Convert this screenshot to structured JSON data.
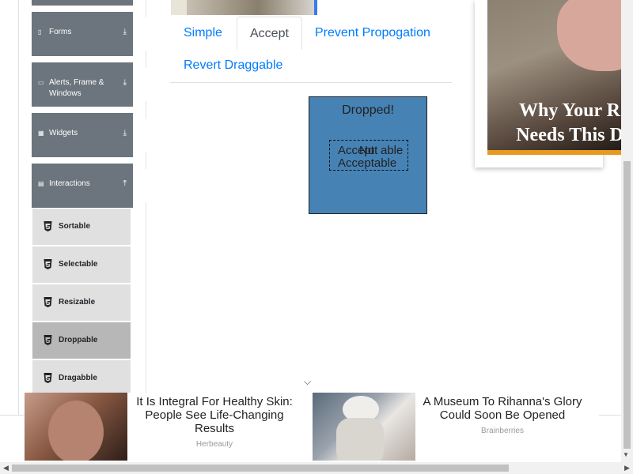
{
  "sidebar": {
    "groups": [
      {
        "label": "Forms",
        "icon": "file-icon",
        "arrow": "download-arrow-icon"
      },
      {
        "label": "Alerts, Frame & Windows",
        "icon": "window-icon",
        "arrow": "download-arrow-icon"
      },
      {
        "label": "Widgets",
        "icon": "grid-icon",
        "arrow": "download-arrow-icon"
      },
      {
        "label": "Interactions",
        "icon": "list-icon",
        "arrow": "upload-arrow-icon"
      }
    ],
    "interactions": [
      {
        "label": "Sortable",
        "active": false
      },
      {
        "label": "Selectable",
        "active": false
      },
      {
        "label": "Resizable",
        "active": false
      },
      {
        "label": "Droppable",
        "active": true
      },
      {
        "label": "Dragabble",
        "active": false
      }
    ]
  },
  "tabs": [
    {
      "label": "Simple",
      "active": false
    },
    {
      "label": "Accept",
      "active": true
    },
    {
      "label": "Prevent Propogation",
      "active": false
    },
    {
      "label": "Revert Draggable",
      "active": false
    }
  ],
  "droppable": {
    "status": "Dropped!",
    "overlap_a": "Accept",
    "overlap_b": "Not",
    "line1_end": "able",
    "line2": "Acceptable"
  },
  "right_ad": {
    "headline_line1": "Why Your R",
    "headline_line2": "Needs This D"
  },
  "bottom_ads": [
    {
      "title": "It Is Integral For Healthy Skin: People See Life-Changing Results",
      "source": "Herbeauty"
    },
    {
      "title": "A Museum To Rihanna's Glory Could Soon Be Opened",
      "source": "Brainberries"
    }
  ],
  "colors": {
    "accent": "#007bff",
    "drop_bg": "#4682b4",
    "sidebar_header": "#6c757d",
    "menu_item": "#e0e0e0",
    "menu_active": "#b7b7b7"
  }
}
